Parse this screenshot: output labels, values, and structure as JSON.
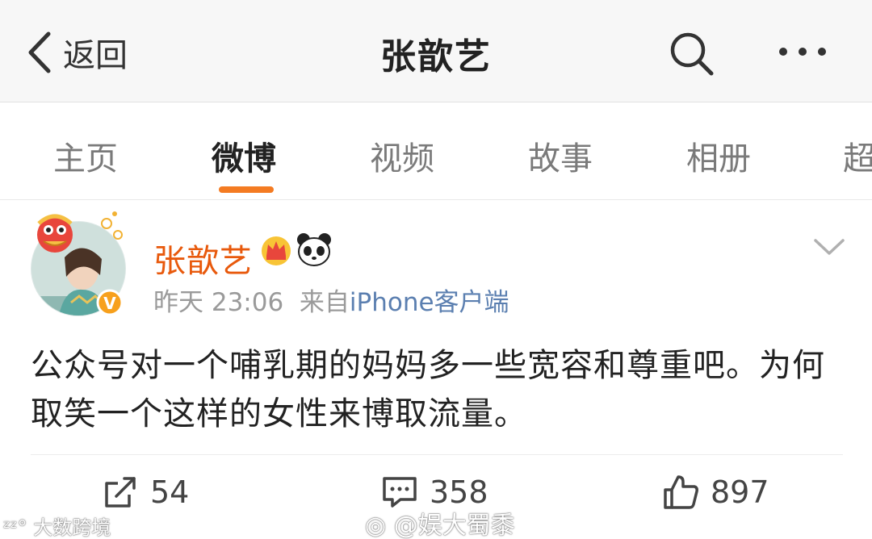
{
  "navbar": {
    "back_label": "返回",
    "title": "张歆艺"
  },
  "tabs": [
    {
      "label": "主页",
      "active": false
    },
    {
      "label": "微博",
      "active": true
    },
    {
      "label": "视频",
      "active": false
    },
    {
      "label": "故事",
      "active": false
    },
    {
      "label": "相册",
      "active": false
    },
    {
      "label": "超",
      "active": false
    }
  ],
  "post": {
    "author": "张歆艺",
    "verified_badge": "V",
    "time": "昨天 23:06",
    "source_prefix": "来自",
    "source": "iPhone客户端",
    "text": "公众号对一个哺乳期的妈妈多一些宽容和尊重吧。为何取笑一个这样的女性来博取流量。",
    "actions": {
      "repost_count": "54",
      "comment_count": "358",
      "like_count": "897"
    }
  },
  "watermarks": {
    "left": "大数跨境",
    "center": "@娱大蜀黍"
  },
  "colors": {
    "accent": "#f47b22",
    "author": "#e8590c",
    "source_link": "#5b7fb0"
  }
}
